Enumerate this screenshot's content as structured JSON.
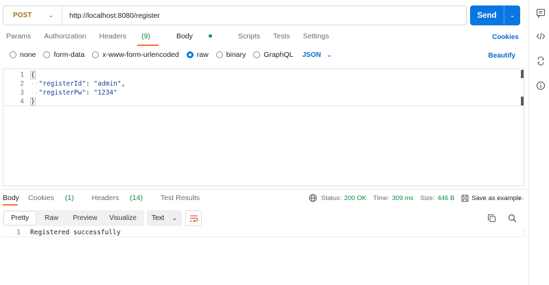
{
  "request": {
    "method": "POST",
    "url": "http://localhost:8080/register",
    "send_label": "Send"
  },
  "request_tabs": {
    "params": "Params",
    "authorization": "Authorization",
    "headers": "Headers",
    "headers_count": "(9)",
    "body": "Body",
    "scripts": "Scripts",
    "tests": "Tests",
    "settings": "Settings",
    "cookies": "Cookies",
    "active": "Body"
  },
  "body_options": {
    "none": "none",
    "form_data": "form-data",
    "urlencoded": "x-www-form-urlencoded",
    "raw": "raw",
    "binary": "binary",
    "graphql": "GraphQL",
    "selected": "raw",
    "language": "JSON",
    "beautify": "Beautify"
  },
  "editor": {
    "lines": [
      {
        "num": "1",
        "text": "{"
      },
      {
        "num": "2",
        "key": "\"registerId\"",
        "value": "\"admin\"",
        "trail": ","
      },
      {
        "num": "3",
        "key": "\"registerPw\"",
        "value": "\"1234\"",
        "trail": ""
      },
      {
        "num": "4",
        "text": "}"
      }
    ]
  },
  "response_tabs": {
    "body": "Body",
    "cookies": "Cookies",
    "cookies_count": "(1)",
    "headers": "Headers",
    "headers_count": "(14)",
    "test_results": "Test Results",
    "active": "Body"
  },
  "response_meta": {
    "status_label": "Status:",
    "status_value": "200 OK",
    "time_label": "Time:",
    "time_value": "309 ms",
    "size_label": "Size:",
    "size_value": "446 B",
    "save_label": "Save as example",
    "more": "···"
  },
  "response_view": {
    "modes": [
      "Pretty",
      "Raw",
      "Preview",
      "Visualize"
    ],
    "active_mode": "Pretty",
    "format": "Text"
  },
  "response_body": {
    "lines": [
      {
        "num": "1",
        "text": "Registered successfully"
      }
    ]
  },
  "colors": {
    "accent": "#0b76e0",
    "tab_indicator": "#ff6c37",
    "success": "#0a8a3a",
    "method_post": "#a6711f"
  }
}
